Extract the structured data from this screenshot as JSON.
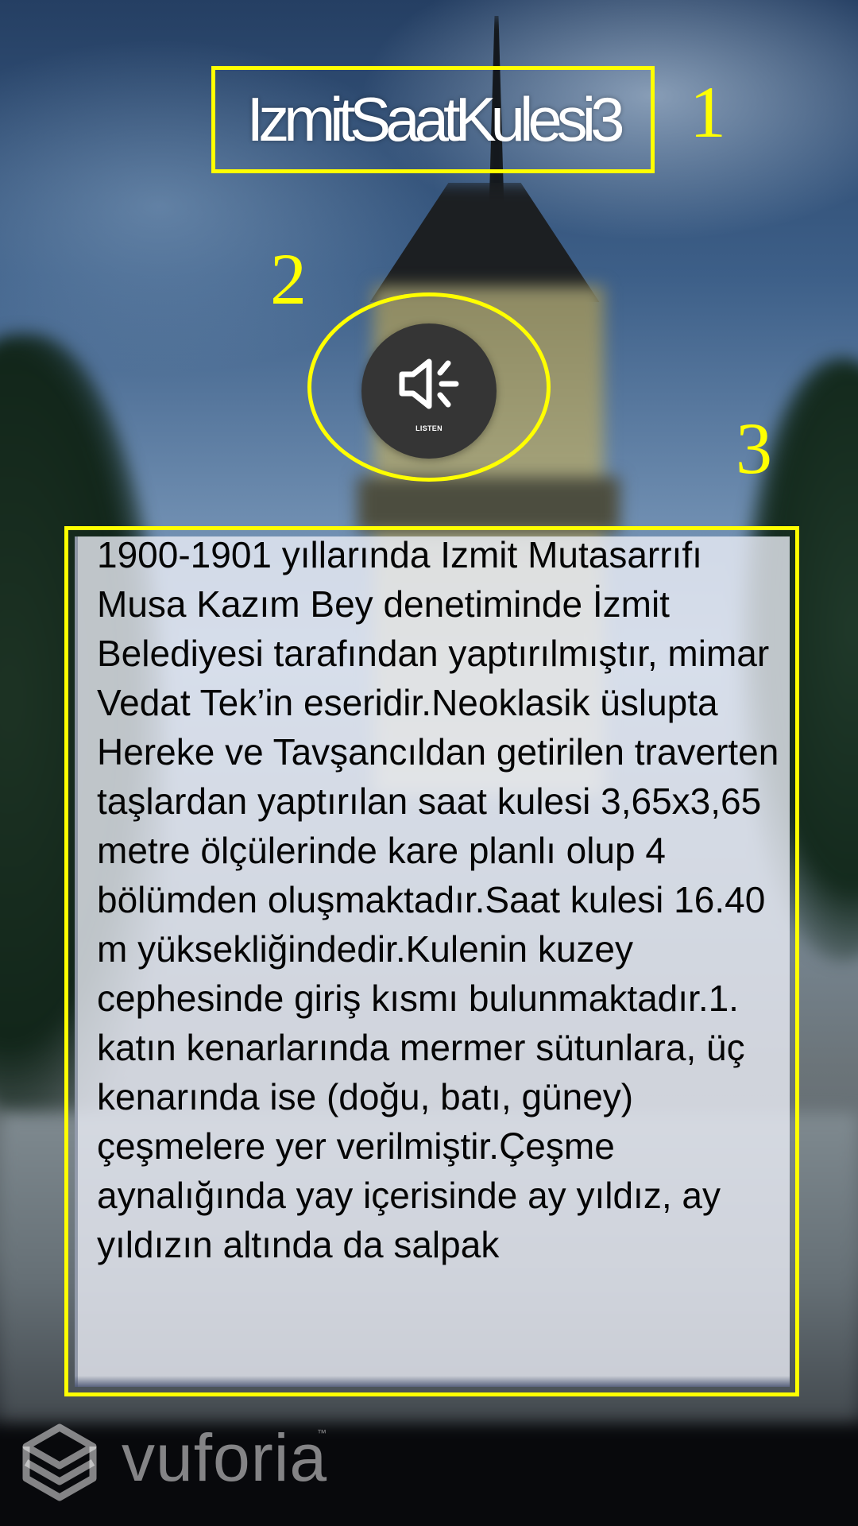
{
  "app": {
    "title": "IzmitSaatKulesi3"
  },
  "annotations": {
    "callout_1": "1",
    "callout_2": "2",
    "callout_3": "3",
    "color": "#ffff00"
  },
  "listen_button": {
    "label": "LISTEN",
    "icon": "speaker-icon",
    "background": "#353535"
  },
  "info_panel": {
    "text": "1900-1901 yıllarında Izmit Mutasarrıfı Musa Kazım Bey denetiminde İzmit Belediyesi tarafından yaptırılmıştır, mimar Vedat Tek’in eseridir.Neoklasik üslupta Hereke ve Tavşancıldan getirilen traverten taşlardan yaptırılan saat kulesi 3,65x3,65 metre ölçülerinde kare planlı olup 4 bölümden oluşmaktadır.Saat kulesi 16.40 m yüksekliğindedir.Kulenin kuzey cephesinde giriş kısmı bulunmaktadır.1. katın kenarlarında mermer sütunlara, üç kenarında ise (doğu, batı, güney) çeşmelere yer verilmiştir.Çeşme aynalığında yay içerisinde ay yıldız, ay yıldızın altında da salpak",
    "background": "#eaecf5"
  },
  "watermark": {
    "brand": "vuforia",
    "trademark": "™",
    "icon": "vuforia-logo-icon"
  }
}
